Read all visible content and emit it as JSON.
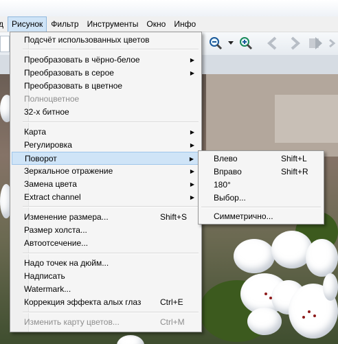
{
  "menubar": {
    "items": [
      {
        "label": "д"
      },
      {
        "label": "Рисунок"
      },
      {
        "label": "Фильтр"
      },
      {
        "label": "Инструменты"
      },
      {
        "label": "Окно"
      },
      {
        "label": "Инфо"
      }
    ]
  },
  "toolbar": {
    "icons": [
      "zoom-out-icon",
      "dropdown-arrow-icon",
      "zoom-in-icon",
      "back-arrow-icon",
      "forward-arrow-icon",
      "thumbnails-icon"
    ]
  },
  "image_menu": {
    "items": [
      {
        "label": "Подсчёт использованных цветов",
        "shortcut": "",
        "submenu": false,
        "disabled": false
      },
      {
        "label": "Преобразовать в чёрно-белое",
        "shortcut": "",
        "submenu": true,
        "disabled": false
      },
      {
        "label": "Преобразовать в серое",
        "shortcut": "",
        "submenu": true,
        "disabled": false
      },
      {
        "label": "Преобразовать в цветное",
        "shortcut": "",
        "submenu": false,
        "disabled": false
      },
      {
        "label": "Полноцветное",
        "shortcut": "",
        "submenu": false,
        "disabled": true
      },
      {
        "label": "32-х битное",
        "shortcut": "",
        "submenu": false,
        "disabled": false
      },
      {
        "label": "Карта",
        "shortcut": "",
        "submenu": true,
        "disabled": false
      },
      {
        "label": "Регулировка",
        "shortcut": "",
        "submenu": true,
        "disabled": false
      },
      {
        "label": "Поворот",
        "shortcut": "",
        "submenu": true,
        "disabled": false,
        "highlighted": true
      },
      {
        "label": "Зеркальное отражение",
        "shortcut": "",
        "submenu": true,
        "disabled": false
      },
      {
        "label": "Замена цвета",
        "shortcut": "",
        "submenu": true,
        "disabled": false
      },
      {
        "label": "Extract channel",
        "shortcut": "",
        "submenu": true,
        "disabled": false
      },
      {
        "label": "Изменение размера...",
        "shortcut": "Shift+S",
        "submenu": false,
        "disabled": false
      },
      {
        "label": "Размер холста...",
        "shortcut": "",
        "submenu": false,
        "disabled": false
      },
      {
        "label": "Автоотсечение...",
        "shortcut": "",
        "submenu": false,
        "disabled": false
      },
      {
        "label": "Надо точек на дюйм...",
        "shortcut": "",
        "submenu": false,
        "disabled": false
      },
      {
        "label": "Надписать",
        "shortcut": "",
        "submenu": false,
        "disabled": false
      },
      {
        "label": "Watermark...",
        "shortcut": "",
        "submenu": false,
        "disabled": false
      },
      {
        "label": "Коррекция эффекта алых глаз",
        "shortcut": "Ctrl+E",
        "submenu": false,
        "disabled": false
      },
      {
        "label": "Изменить карту цветов...",
        "shortcut": "Ctrl+M",
        "submenu": false,
        "disabled": true
      }
    ]
  },
  "rotate_submenu": {
    "items": [
      {
        "label": "Влево",
        "shortcut": "Shift+L"
      },
      {
        "label": "Вправо",
        "shortcut": "Shift+R"
      },
      {
        "label": "180°",
        "shortcut": ""
      },
      {
        "label": "Выбор...",
        "shortcut": ""
      },
      {
        "label": "Симметрично...",
        "shortcut": ""
      }
    ]
  },
  "colors": {
    "highlight": "#cfe4f7",
    "highlight_border": "#9ec5ea",
    "disabled_text": "#8d8d8d"
  }
}
